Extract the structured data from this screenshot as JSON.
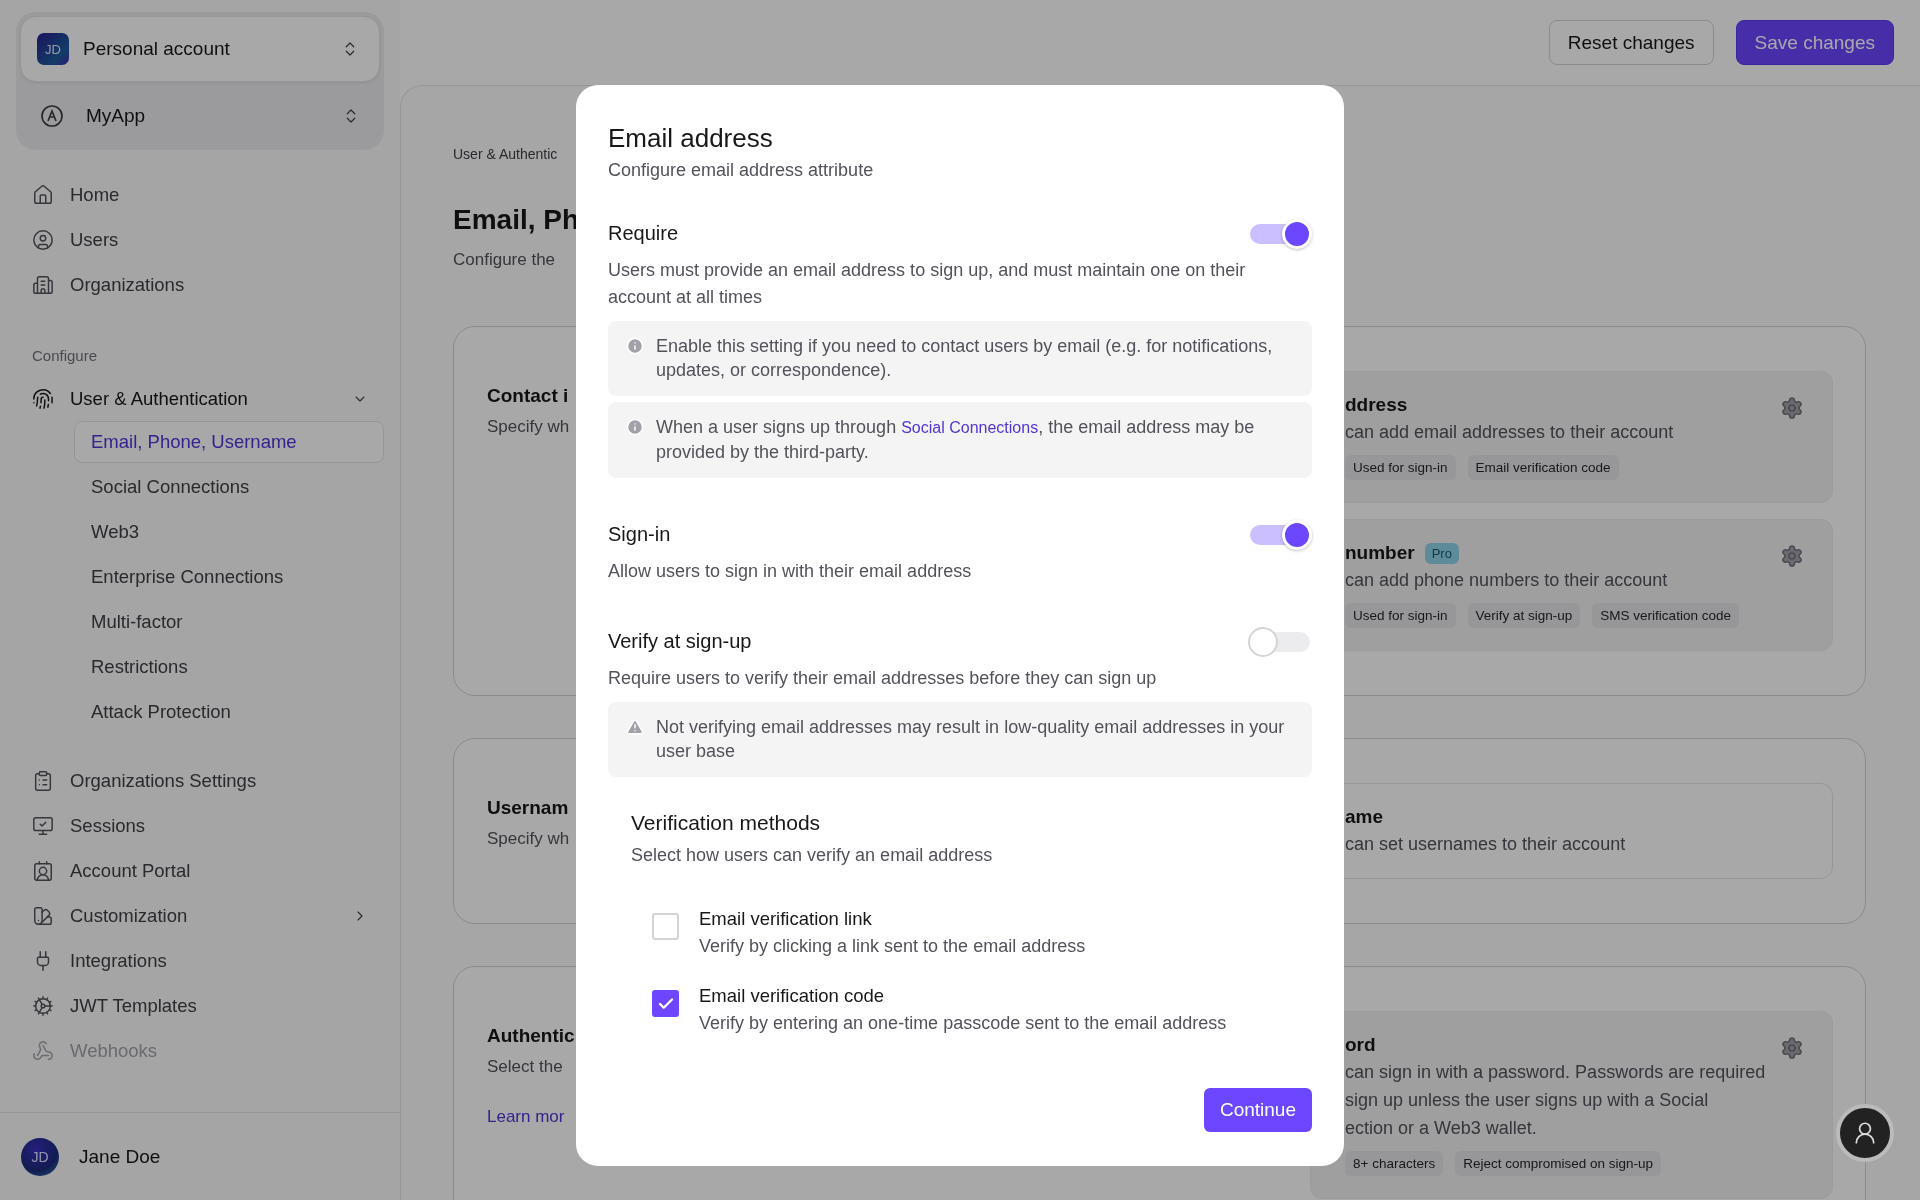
{
  "header": {
    "buttons": [
      {
        "label": "Reset changes",
        "kind": "secondary"
      },
      {
        "label": "Save changes",
        "kind": "primary"
      }
    ]
  },
  "sidebar": {
    "account": {
      "avatar": "JD",
      "name": "Personal account"
    },
    "app": {
      "name": "MyApp"
    },
    "nav": [
      {
        "label": "Home",
        "selected": false
      },
      {
        "label": "Users",
        "selected": false
      },
      {
        "label": "Organizations",
        "selected": false
      }
    ],
    "section": {
      "heading": "Configure",
      "items": [
        {
          "label": "User & Authentication",
          "disabled": false,
          "expanded": true,
          "children": [
            {
              "label": "Email, Phone, Username",
              "selected": true
            },
            {
              "label": "Social Connections",
              "selected": false
            },
            {
              "label": "Web3",
              "selected": false
            },
            {
              "label": "Enterprise Connections",
              "selected": false
            },
            {
              "label": "Multi-factor",
              "selected": false
            },
            {
              "label": "Restrictions",
              "selected": false
            },
            {
              "label": "Attack Protection",
              "selected": false
            }
          ]
        },
        {
          "label": "Organizations Settings",
          "disabled": false
        },
        {
          "label": "Sessions",
          "disabled": false
        },
        {
          "label": "Account Portal",
          "disabled": false
        },
        {
          "label": "Customization",
          "disabled": false,
          "expanded": false
        },
        {
          "label": "Integrations",
          "disabled": false
        },
        {
          "label": "JWT Templates",
          "disabled": false
        },
        {
          "label": "Webhooks",
          "disabled": true
        }
      ]
    },
    "user": {
      "avatar": "JD",
      "name": "Jane Doe"
    }
  },
  "main": {
    "breadcrumb": "User & Authentic",
    "title": "Email, Ph",
    "subtitle": "Configure the",
    "sections": [
      {
        "title": "Contact i",
        "description": "Specify wh",
        "items": [
          {
            "kind": "configurable",
            "title": "ddress",
            "lines": [
              "can add email addresses to their account"
            ],
            "tags": [
              "Used for sign-in",
              "Email verification code"
            ]
          },
          {
            "kind": "configurable",
            "title": "number",
            "badge": "Pro",
            "lines": [
              "can add phone numbers to their account"
            ],
            "tags": [
              "Used for sign-in",
              "Verify at sign-up",
              "SMS verification code"
            ]
          }
        ]
      },
      {
        "title": "Usernam",
        "description": "Specify wh",
        "items": [
          {
            "kind": "plain",
            "title": "ame",
            "lines": [
              "can set usernames to their account"
            ]
          }
        ]
      },
      {
        "title": "Authentic",
        "description": "Select the",
        "link": "Learn mor",
        "items": [
          {
            "kind": "configurable",
            "title": "ord",
            "lines": [
              "can sign in with a password. Passwords are required",
              "sign up unless the user signs up with a Social",
              "ection or a Web3 wallet."
            ],
            "tags": [
              "8+ characters",
              "Reject compromised on sign-up"
            ]
          }
        ]
      }
    ]
  },
  "modal": {
    "title": "Email address",
    "subtitle": "Configure email address attribute",
    "settings": [
      {
        "title": "Require",
        "description": "Users must provide an email address to sign up, and must maintain one on their account at all times",
        "on": true,
        "notes": [
          {
            "kind": "info",
            "text": "Enable this setting if you need to contact users by email (e.g. for notifications, updates, or correspondence)."
          },
          {
            "kind": "info",
            "text": "When a user signs up through ",
            "link": "Social Connections",
            "text_after": ", the email address may be provided by the third-party."
          }
        ]
      },
      {
        "title": "Sign-in",
        "description": "Allow users to sign in with their email address",
        "on": true
      },
      {
        "title": "Verify at sign-up",
        "description": "Require users to verify their email addresses before they can sign up",
        "on": false,
        "notes": [
          {
            "kind": "warning",
            "text": "Not verifying email addresses may result in low-quality email addresses in your user base"
          }
        ]
      }
    ],
    "verification": {
      "title": "Verification methods",
      "description": "Select how users can verify an email address",
      "methods": [
        {
          "label": "Email verification link",
          "description": "Verify by clicking a link sent to the email address",
          "checked": false
        },
        {
          "label": "Email verification code",
          "description": "Verify by entering an one-time passcode sent to the email address",
          "checked": true
        }
      ]
    },
    "button": "Continue"
  }
}
